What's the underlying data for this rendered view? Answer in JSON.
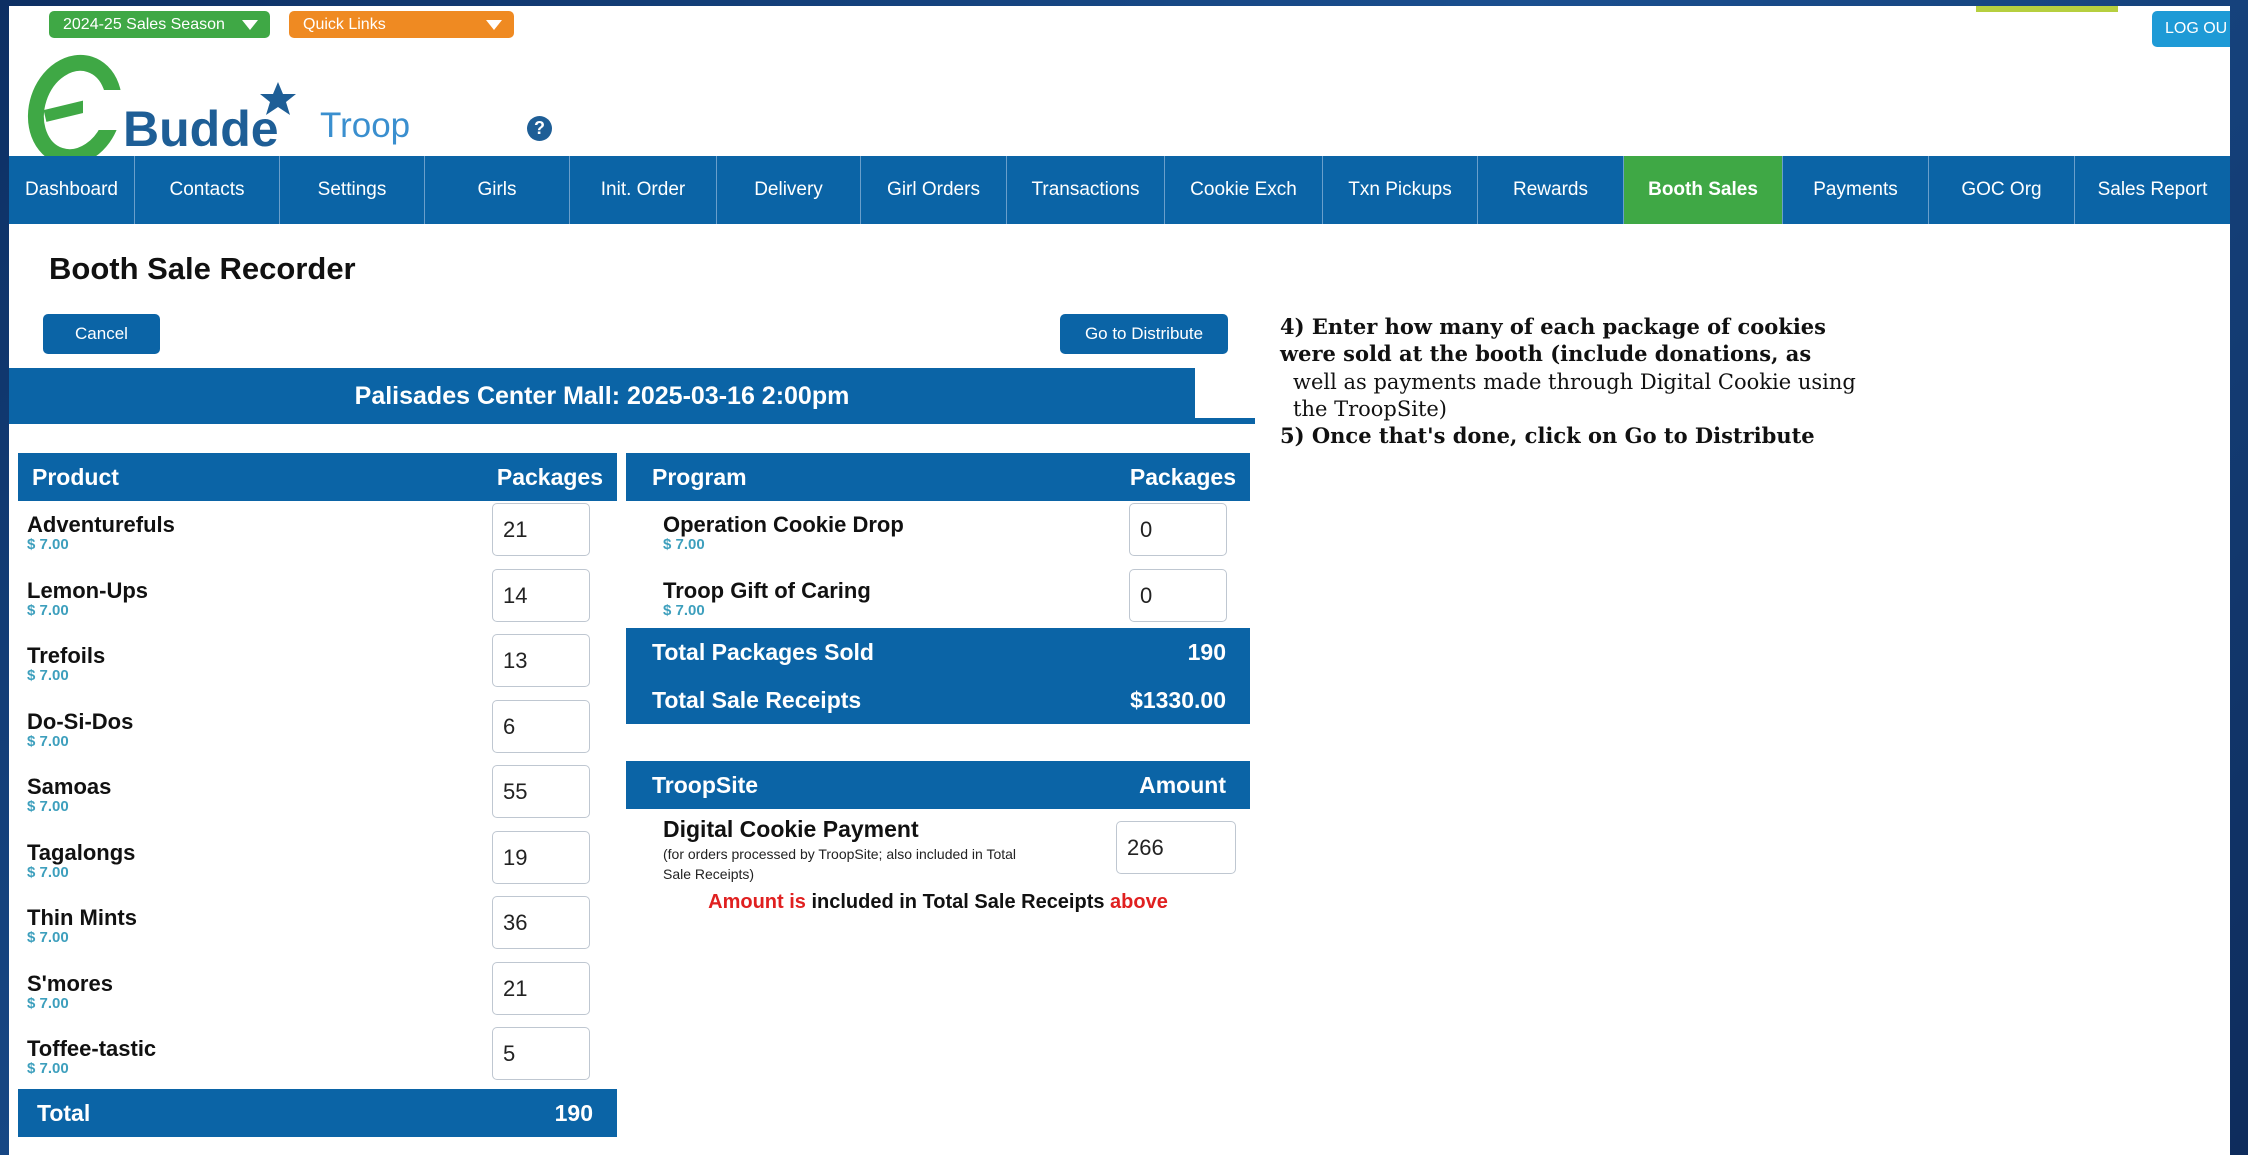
{
  "topbar": {
    "season_label": "2024-25 Sales Season",
    "quick_links_label": "Quick Links",
    "logout_label": "LOG OU"
  },
  "logo": {
    "brand": "Budde",
    "troop_label": "Troop"
  },
  "nav": {
    "items": [
      "Dashboard",
      "Contacts",
      "Settings",
      "Girls",
      "Init. Order",
      "Delivery",
      "Girl Orders",
      "Transactions",
      "Cookie Exch",
      "Txn Pickups",
      "Rewards",
      "Booth Sales",
      "Payments",
      "GOC Org",
      "Sales Report"
    ],
    "active": "Booth Sales"
  },
  "page": {
    "title": "Booth Sale Recorder",
    "cancel_label": "Cancel",
    "distribute_label": "Go to Distribute",
    "event": "Palisades Center Mall: 2025-03-16 2:00pm"
  },
  "notes": {
    "step4_a": "4) Enter how many of each package of cookies were sold at the booth (include donations, as",
    "step4_b": "well as payments made through Digital Cookie using the TroopSite)",
    "step5": "5) Once that's done, click on Go to Distribute"
  },
  "products": {
    "header_product": "Product",
    "header_packages": "Packages",
    "items": [
      {
        "name": "Adventurefuls",
        "price": "$ 7.00",
        "qty": "21"
      },
      {
        "name": "Lemon-Ups",
        "price": "$ 7.00",
        "qty": "14"
      },
      {
        "name": "Trefoils",
        "price": "$ 7.00",
        "qty": "13"
      },
      {
        "name": "Do-Si-Dos",
        "price": "$ 7.00",
        "qty": "6"
      },
      {
        "name": "Samoas",
        "price": "$ 7.00",
        "qty": "55"
      },
      {
        "name": "Tagalongs",
        "price": "$ 7.00",
        "qty": "19"
      },
      {
        "name": "Thin Mints",
        "price": "$ 7.00",
        "qty": "36"
      },
      {
        "name": "S'mores",
        "price": "$ 7.00",
        "qty": "21"
      },
      {
        "name": "Toffee-tastic",
        "price": "$ 7.00",
        "qty": "5"
      }
    ],
    "total_label": "Total",
    "total_value": "190"
  },
  "programs": {
    "header_program": "Program",
    "header_packages": "Packages",
    "items": [
      {
        "name": "Operation Cookie Drop",
        "price": "$ 7.00",
        "qty": "0"
      },
      {
        "name": "Troop Gift of Caring",
        "price": "$ 7.00",
        "qty": "0"
      }
    ],
    "total_packages_label": "Total Packages Sold",
    "total_packages_value": "190",
    "total_receipts_label": "Total Sale Receipts",
    "total_receipts_value": "$1330.00"
  },
  "troopsite": {
    "header_label": "TroopSite",
    "header_amount": "Amount",
    "payment_name": "Digital Cookie Payment",
    "payment_desc": "(for orders processed by TroopSite; also included in Total Sale Receipts)",
    "payment_value": "266",
    "note_red_1": "Amount is",
    "note_black": " included in Total Sale Receipts ",
    "note_red_2": "above"
  },
  "colors": {
    "primary_blue": "#0b64a6",
    "active_green": "#3fa845",
    "quick_orange": "#ef8a22",
    "price_teal": "#3d9fbd",
    "alert_red": "#e02020"
  }
}
